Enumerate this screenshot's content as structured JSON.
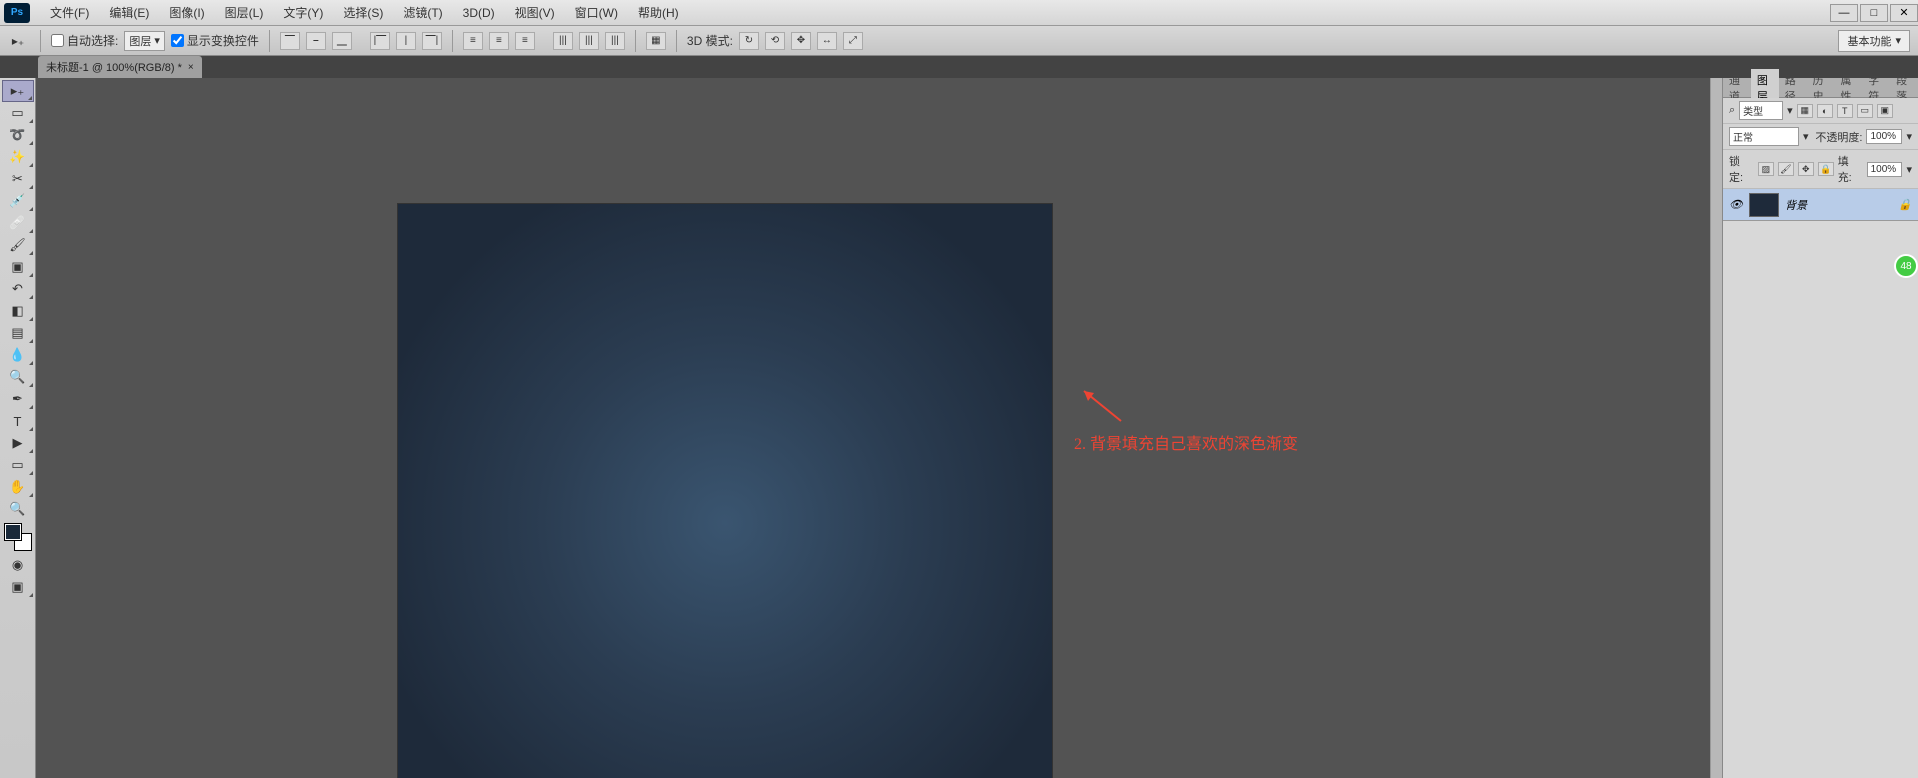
{
  "app": {
    "logo": "Ps"
  },
  "menu": {
    "file": "文件(F)",
    "edit": "编辑(E)",
    "image": "图像(I)",
    "layer": "图层(L)",
    "type": "文字(Y)",
    "select": "选择(S)",
    "filter": "滤镜(T)",
    "threeD": "3D(D)",
    "view": "视图(V)",
    "window": "窗口(W)",
    "help": "帮助(H)"
  },
  "win": {
    "min": "—",
    "max": "□",
    "close": "✕"
  },
  "options": {
    "autoSelect": "自动选择:",
    "autoSelectTarget": "图层",
    "showTransform": "显示变换控件",
    "threeDMode": "3D 模式:"
  },
  "workspace": {
    "label": "基本功能"
  },
  "docTab": {
    "title": "未标题-1 @ 100%(RGB/8) *",
    "close": "×"
  },
  "annotation": {
    "text": "2. 背景填充自己喜欢的深色渐变"
  },
  "panels": {
    "tabs": {
      "channel": "通道",
      "layer": "图层",
      "path": "路径",
      "history": "历史",
      "properties": "属性",
      "character": "字符",
      "paragraph": "段落"
    },
    "kind": "类型",
    "blend": "正常",
    "opacityLabel": "不透明度:",
    "opacity": "100%",
    "lockLabel": "锁定:",
    "fillLabel": "填充:",
    "fill": "100%",
    "layerName": "背景"
  },
  "badge": {
    "text": "48"
  }
}
